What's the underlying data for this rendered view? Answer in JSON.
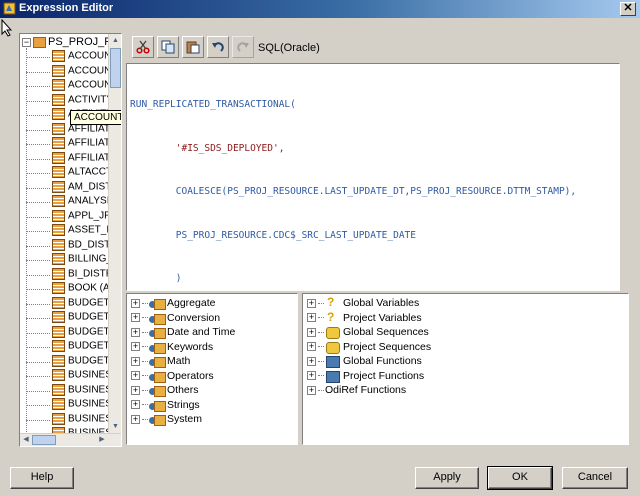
{
  "window": {
    "title": "Expression Editor",
    "close_glyph": "✕"
  },
  "tree": {
    "root_label": "PS_PROJ_RES",
    "items": [
      "ACCOUNT",
      "ACCOUNT",
      "ACCOUNT",
      "ACTIVITY",
      "ACTIVITY",
      "AFFILIAT",
      "AFFILIAT",
      "AFFILIAT",
      "ALTACCT",
      "AM_DISTI",
      "ANALYSIS",
      "APPL_JRN",
      "ASSET_ID",
      "BD_DISTF",
      "BILLING_I",
      "BI_DISTR",
      "BOOK (As",
      "BUDGET_",
      "BUDGET_",
      "BUDGET_",
      "BUDGET_",
      "BUDGET_",
      "BUSINESS",
      "BUSINESS",
      "BUSINESS",
      "BUSINESS",
      "BUSINESS"
    ],
    "tooltip": "ACCOUNT (Account)"
  },
  "toolbar": {
    "buttons": [
      "cut-icon",
      "copy-icon",
      "paste-icon",
      "undo-icon",
      "redo-icon"
    ],
    "language_label": "SQL(Oracle)"
  },
  "editor": {
    "lines": [
      "RUN_REPLICATED_TRANSACTIONAL(",
      "        '#IS_SDS_DEPLOYED',",
      "        COALESCE(PS_PROJ_RESOURCE.LAST_UPDATE_DT,PS_PROJ_RESOURCE.DTTM_STAMP),",
      "        PS_PROJ_RESOURCE.CDC$_SRC_LAST_UPDATE_DATE",
      "        )"
    ]
  },
  "functions": {
    "items": [
      "Aggregate",
      "Conversion",
      "Date and Time",
      "Keywords",
      "Math",
      "Operators",
      "Others",
      "Strings",
      "System"
    ]
  },
  "variables": {
    "items": [
      {
        "label": "Global Variables",
        "icon": "variable-icon"
      },
      {
        "label": "Project Variables",
        "icon": "variable-icon"
      },
      {
        "label": "Global Sequences",
        "icon": "sequence-icon"
      },
      {
        "label": "Project Sequences",
        "icon": "sequence-icon"
      },
      {
        "label": "Global Functions",
        "icon": "function-icon"
      },
      {
        "label": "Project Functions",
        "icon": "function-icon"
      },
      {
        "label": "OdiRef Functions",
        "icon": "none"
      }
    ]
  },
  "buttons": {
    "help": "Help",
    "apply": "Apply",
    "ok": "OK",
    "cancel": "Cancel"
  }
}
